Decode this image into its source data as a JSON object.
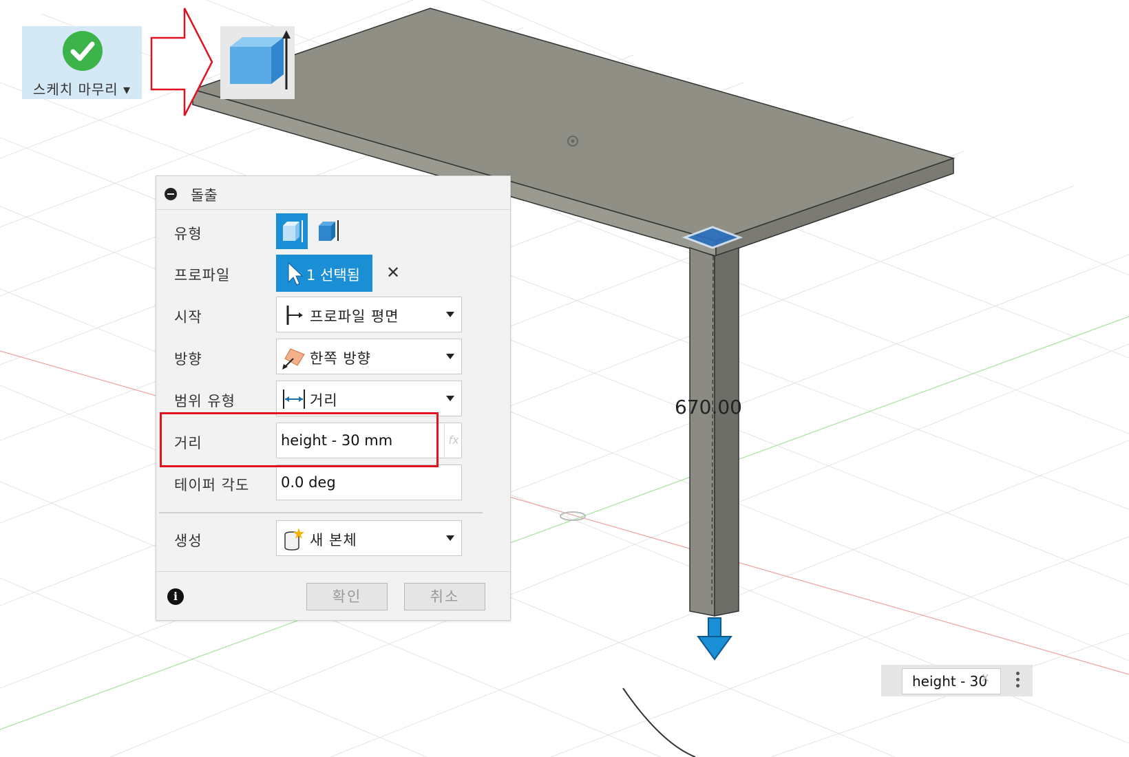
{
  "toolbar": {
    "finish_sketch_label": "스케치 마무리 ▾",
    "extrude_tool_icon": "extrude-icon"
  },
  "dialog": {
    "title": "돌출",
    "type": {
      "label": "유형"
    },
    "profile": {
      "label": "프로파일",
      "value": "1 선택됨"
    },
    "start": {
      "label": "시작",
      "value": "프로파일 평면"
    },
    "direction": {
      "label": "방향",
      "value": "한쪽 방향"
    },
    "extent_type": {
      "label": "범위 유형",
      "value": "거리"
    },
    "distance": {
      "label": "거리",
      "value": "height - 30 mm",
      "fx": "fx"
    },
    "taper": {
      "label": "테이퍼 각도",
      "value": "0.0 deg"
    },
    "operation": {
      "label": "생성",
      "value": "새 본체"
    },
    "ok_label": "확인",
    "cancel_label": "취소"
  },
  "viewport": {
    "dimension_label": "670.00",
    "mini_input_value": "height - 30",
    "mini_input_clear": "x"
  },
  "colors": {
    "accent": "#1a8fd6",
    "highlight": "#e2111f",
    "body": "#8f8f86"
  }
}
